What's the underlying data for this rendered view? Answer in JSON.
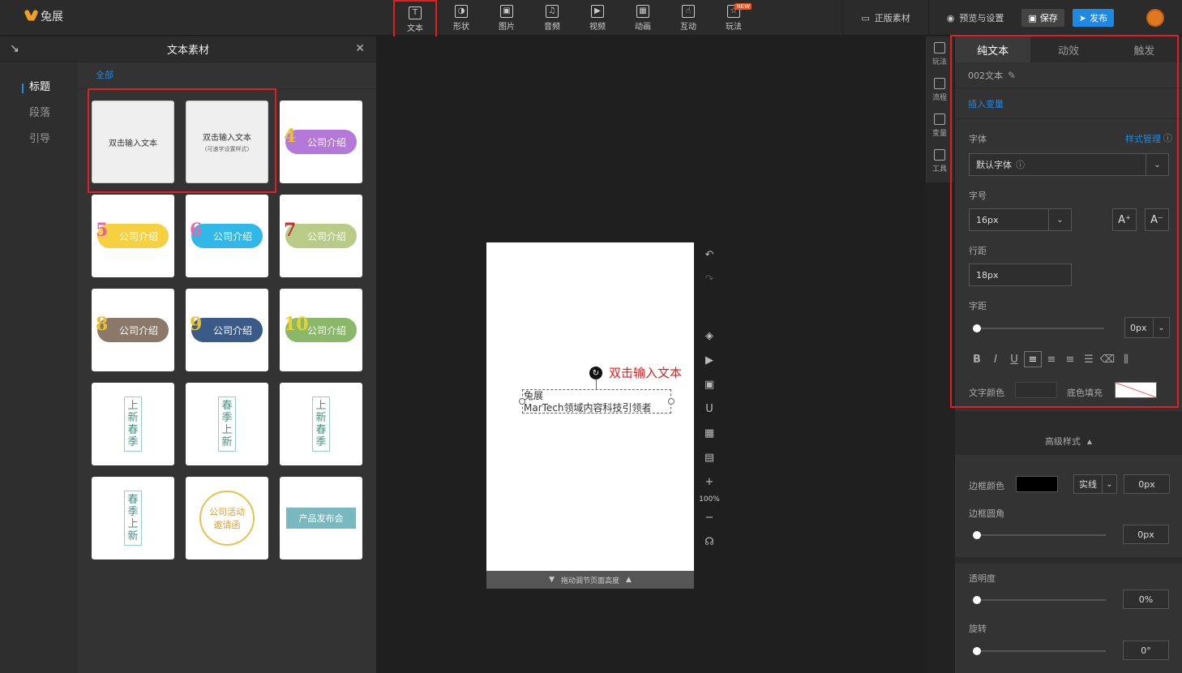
{
  "app": {
    "logo_text": "兔展"
  },
  "toolbar": {
    "tools": [
      {
        "label": "文本",
        "icon": "T"
      },
      {
        "label": "形状",
        "icon": "◑"
      },
      {
        "label": "图片",
        "icon": "▣"
      },
      {
        "label": "音频",
        "icon": "♫"
      },
      {
        "label": "视频",
        "icon": "▶"
      },
      {
        "label": "动画",
        "icon": "▦"
      },
      {
        "label": "互动",
        "icon": "☝"
      },
      {
        "label": "玩法",
        "icon": "☆",
        "badge": "NEW"
      }
    ],
    "material_label": "正版素材",
    "preview_label": "预览与设置",
    "save_label": "保存",
    "publish_label": "发布"
  },
  "left_panel": {
    "title": "文本素材",
    "categories": [
      "标题",
      "段落",
      "引导"
    ],
    "filter": "全部",
    "tiles": [
      {
        "text": "双击输入文本",
        "sub": ""
      },
      {
        "text": "双击输入文本",
        "sub": "(可速字设置样式)"
      },
      {
        "num": "4",
        "text": "公司介绍",
        "color": "#b478d8",
        "numcolor": "#e8c030"
      },
      {
        "num": "5",
        "text": "公司介绍",
        "color": "#f5d040",
        "numcolor": "#e860a0"
      },
      {
        "num": "6",
        "text": "公司介绍",
        "color": "#30b8e8",
        "numcolor": "#e868a8"
      },
      {
        "num": "7",
        "text": "公司介绍",
        "color": "#b8cc88",
        "numcolor": "#c03030"
      },
      {
        "num": "8",
        "text": "公司介绍",
        "color": "#8a7868",
        "numcolor": "#e8c030"
      },
      {
        "num": "9",
        "text": "公司介绍",
        "color": "#3a5a88",
        "numcolor": "#e8c030"
      },
      {
        "num": "10",
        "text": "公司介绍",
        "color": "#88b868",
        "numcolor": "#e8d030"
      },
      {
        "text": "上新春季",
        "style": "spring1"
      },
      {
        "text": "春季上新",
        "style": "spring2"
      },
      {
        "text": "上新春季",
        "style": "spring3"
      },
      {
        "text": "春季上新",
        "style": "spring4"
      },
      {
        "text": "公司活动邀请函",
        "style": "invite"
      },
      {
        "text": "产品发布会",
        "style": "launch"
      }
    ]
  },
  "canvas": {
    "text_line1": "兔展",
    "text_line2": "MarTech领域内容科技引领者",
    "callout": "双击输入文本",
    "footer": "拖动调节页面高度",
    "zoom": "100%"
  },
  "side_tabs": [
    "玩法",
    "流程",
    "变量",
    "工具"
  ],
  "right_panel": {
    "tabs": [
      "纯文本",
      "动效",
      "触发"
    ],
    "element_name": "002文本",
    "insert_variable": "插入变量",
    "font_label": "字体",
    "style_manage": "样式管理",
    "font_value": "默认字体",
    "size_label": "字号",
    "size_value": "16px",
    "line_height_label": "行距",
    "line_height_value": "18px",
    "spacing_label": "字距",
    "spacing_value": "0px",
    "text_color_label": "文字颜色",
    "bg_fill_label": "底色填充",
    "advanced_label": "高级样式",
    "border_color_label": "边框颜色",
    "border_style": "实线",
    "border_width": "0px",
    "radius_label": "边框圆角",
    "radius_value": "0px",
    "opacity_label": "透明度",
    "opacity_value": "0%",
    "rotate_label": "旋转",
    "rotate_value": "0°"
  }
}
